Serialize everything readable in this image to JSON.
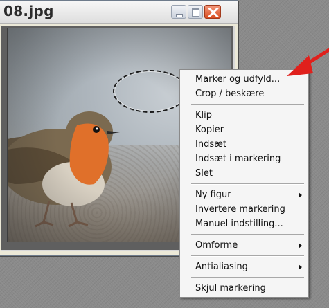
{
  "window": {
    "title": "08.jpg",
    "controls": {
      "minimize": "minimize",
      "maximize": "maximize",
      "close": "close"
    }
  },
  "context_menu": {
    "groups": [
      [
        {
          "label": "Marker og udfyld...",
          "submenu": false
        },
        {
          "label": "Crop / beskære",
          "submenu": false
        }
      ],
      [
        {
          "label": "Klip",
          "submenu": false
        },
        {
          "label": "Kopier",
          "submenu": false
        },
        {
          "label": "Indsæt",
          "submenu": false
        },
        {
          "label": "Indsæt i markering",
          "submenu": false
        },
        {
          "label": "Slet",
          "submenu": false
        }
      ],
      [
        {
          "label": "Ny figur",
          "submenu": true
        },
        {
          "label": "Invertere markering",
          "submenu": false
        },
        {
          "label": "Manuel indstilling...",
          "submenu": false
        }
      ],
      [
        {
          "label": "Omforme",
          "submenu": true
        }
      ],
      [
        {
          "label": "Antialiasing",
          "submenu": true
        }
      ],
      [
        {
          "label": "Skjul markering",
          "submenu": false
        }
      ]
    ]
  },
  "colors": {
    "annotation_arrow": "#e0201c",
    "menu_background": "#f5f5f5",
    "close_button": "#d74b1f"
  },
  "icons": {
    "submenu": "chevron-right-icon",
    "close": "close-icon"
  }
}
